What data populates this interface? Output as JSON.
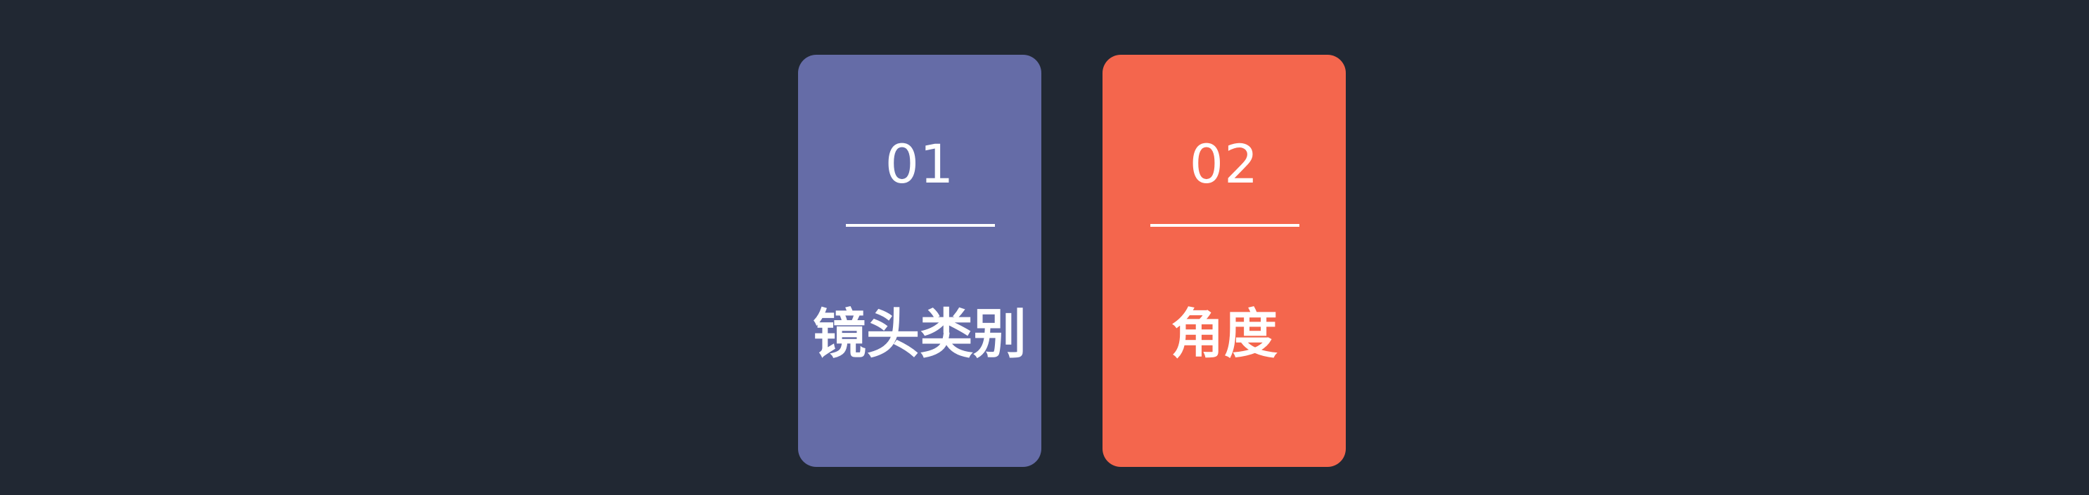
{
  "cards": [
    {
      "number": "01",
      "label": "镜头类别",
      "color": "#656ca7"
    },
    {
      "number": "02",
      "label": "角度",
      "color": "#f4664d"
    }
  ],
  "background_color": "#212833"
}
